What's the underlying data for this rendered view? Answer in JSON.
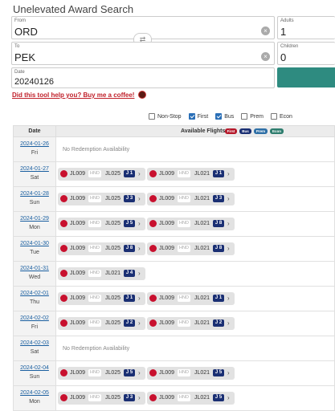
{
  "title": "Unelevated Award Search",
  "from": {
    "label": "From",
    "value": "ORD"
  },
  "to": {
    "label": "To",
    "value": "PEK"
  },
  "date": {
    "label": "Date",
    "value": "20240126"
  },
  "adults": {
    "label": "Adults",
    "value": "1"
  },
  "children": {
    "label": "Children",
    "value": "0"
  },
  "coffee_link": "Did this tool help you? Buy me a coffee!",
  "filters": [
    {
      "label": "Non-Stop",
      "checked": false
    },
    {
      "label": "First",
      "checked": true
    },
    {
      "label": "Bus",
      "checked": true
    },
    {
      "label": "Prem",
      "checked": false
    },
    {
      "label": "Econ",
      "checked": false
    }
  ],
  "table": {
    "date_header": "Date",
    "flights_header": "Available Flights",
    "badges": [
      {
        "label": "First",
        "color": "#b5182a"
      },
      {
        "label": "Bus",
        "color": "#1a2f73"
      },
      {
        "label": "Prem",
        "color": "#2e6fa6"
      },
      {
        "label": "Econ",
        "color": "#2e7d6e"
      }
    ],
    "no_avail_text": "No Redemption Availability",
    "rows": [
      {
        "date": "2024-01-26",
        "day": "Fri",
        "flights": []
      },
      {
        "date": "2024-01-27",
        "day": "Sat",
        "flights": [
          {
            "f1": "JL009",
            "via": "HND",
            "f2": "JL025",
            "cls": "J 1"
          },
          {
            "f1": "JL009",
            "via": "HND",
            "f2": "JL021",
            "cls": "J 1"
          }
        ]
      },
      {
        "date": "2024-01-28",
        "day": "Sun",
        "flights": [
          {
            "f1": "JL009",
            "via": "HND",
            "f2": "JL025",
            "cls": "J 3"
          },
          {
            "f1": "JL009",
            "via": "HND",
            "f2": "JL021",
            "cls": "J 3"
          }
        ]
      },
      {
        "date": "2024-01-29",
        "day": "Mon",
        "flights": [
          {
            "f1": "JL009",
            "via": "HND",
            "f2": "JL025",
            "cls": "J 5"
          },
          {
            "f1": "JL009",
            "via": "HND",
            "f2": "JL021",
            "cls": "J 8"
          }
        ]
      },
      {
        "date": "2024-01-30",
        "day": "Tue",
        "flights": [
          {
            "f1": "JL009",
            "via": "HND",
            "f2": "JL025",
            "cls": "J 8"
          },
          {
            "f1": "JL009",
            "via": "HND",
            "f2": "JL021",
            "cls": "J 8"
          }
        ]
      },
      {
        "date": "2024-01-31",
        "day": "Wed",
        "flights": [
          {
            "f1": "JL009",
            "via": "HND",
            "f2": "JL021",
            "cls": "J 4"
          }
        ]
      },
      {
        "date": "2024-02-01",
        "day": "Thu",
        "flights": [
          {
            "f1": "JL009",
            "via": "HND",
            "f2": "JL025",
            "cls": "J 1"
          },
          {
            "f1": "JL009",
            "via": "HND",
            "f2": "JL021",
            "cls": "J 1"
          }
        ]
      },
      {
        "date": "2024-02-02",
        "day": "Fri",
        "flights": [
          {
            "f1": "JL009",
            "via": "HND",
            "f2": "JL025",
            "cls": "J 2"
          },
          {
            "f1": "JL009",
            "via": "HND",
            "f2": "JL021",
            "cls": "J 2"
          }
        ]
      },
      {
        "date": "2024-02-03",
        "day": "Sat",
        "flights": []
      },
      {
        "date": "2024-02-04",
        "day": "Sun",
        "flights": [
          {
            "f1": "JL009",
            "via": "HND",
            "f2": "JL025",
            "cls": "J 5"
          },
          {
            "f1": "JL009",
            "via": "HND",
            "f2": "JL021",
            "cls": "J 5"
          }
        ]
      },
      {
        "date": "2024-02-05",
        "day": "Mon",
        "flights": [
          {
            "f1": "JL009",
            "via": "HND",
            "f2": "JL025",
            "cls": "J 3"
          },
          {
            "f1": "JL009",
            "via": "HND",
            "f2": "JL021",
            "cls": "J 5"
          }
        ]
      }
    ]
  }
}
